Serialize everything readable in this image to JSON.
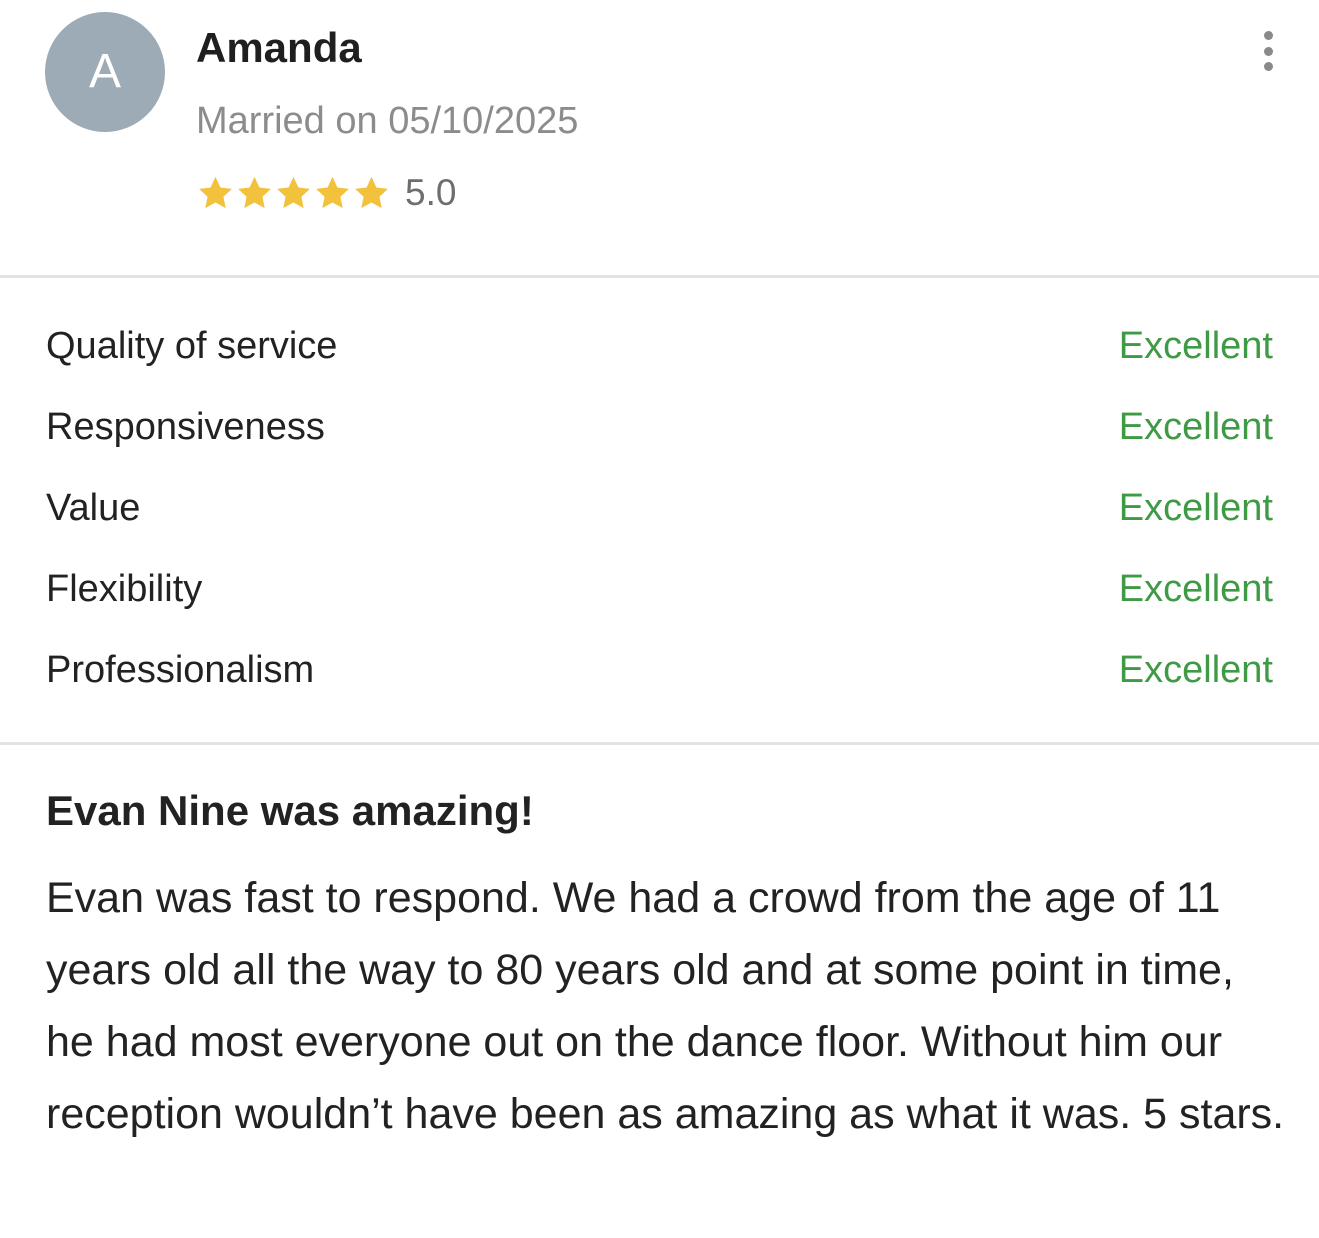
{
  "reviewer": {
    "initial": "A",
    "name": "Amanda",
    "wedding_date": "Married on 05/10/2025",
    "stars": 5,
    "rating": "5.0"
  },
  "colors": {
    "avatar_bg": "#9cabb5",
    "star": "#f2c23c",
    "excellent": "#3f9a45"
  },
  "icons": {
    "menu": "more-vertical-icon",
    "star": "star-icon"
  },
  "ratings": [
    {
      "label": "Quality of service",
      "score": "Excellent"
    },
    {
      "label": "Responsiveness",
      "score": "Excellent"
    },
    {
      "label": "Value",
      "score": "Excellent"
    },
    {
      "label": "Flexibility",
      "score": "Excellent"
    },
    {
      "label": "Professionalism",
      "score": "Excellent"
    }
  ],
  "review": {
    "title": "Evan Nine was amazing!",
    "body": "Evan was fast to respond. We had a crowd from the age of 11 years old all the way to 80 years old and at some point in time, he had most everyone out on the dance floor. Without him our reception wouldn’t have been as amazing as what it was. 5 stars."
  }
}
